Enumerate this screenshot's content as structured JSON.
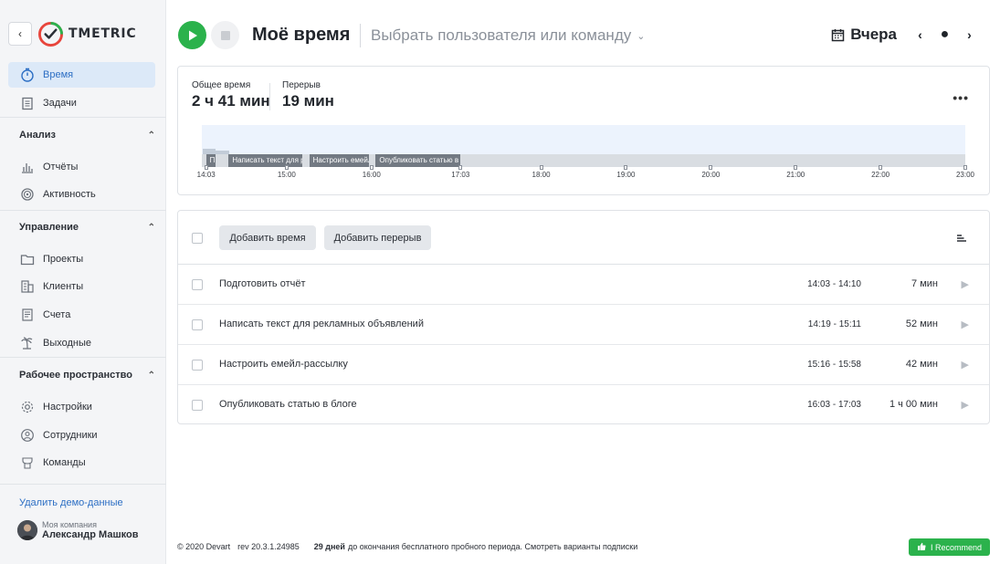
{
  "brand": {
    "name": "TMETRIC",
    "accent": "#2bb24c",
    "link": "#2d6fc4"
  },
  "sidebar": {
    "collapse_icon": "chevron-left-icon",
    "nav_top": [
      {
        "label": "Время",
        "icon": "stopwatch-icon",
        "active": true
      },
      {
        "label": "Задачи",
        "icon": "clipboard-icon",
        "active": false
      }
    ],
    "sections": [
      {
        "title": "Анализ",
        "items": [
          {
            "label": "Отчёты",
            "icon": "bar-chart-icon"
          },
          {
            "label": "Активность",
            "icon": "activity-icon"
          }
        ]
      },
      {
        "title": "Управление",
        "items": [
          {
            "label": "Проекты",
            "icon": "folder-icon"
          },
          {
            "label": "Клиенты",
            "icon": "building-icon"
          },
          {
            "label": "Счета",
            "icon": "invoice-icon"
          },
          {
            "label": "Выходные",
            "icon": "palm-tree-icon"
          }
        ]
      },
      {
        "title": "Рабочее пространство",
        "items": [
          {
            "label": "Настройки",
            "icon": "gear-icon"
          },
          {
            "label": "Сотрудники",
            "icon": "person-icon"
          },
          {
            "label": "Команды",
            "icon": "team-icon"
          }
        ]
      }
    ],
    "demo_link": "Удалить демо-данные",
    "user": {
      "company": "Моя компания",
      "name": "Александр Машков"
    }
  },
  "header": {
    "title": "Моё время",
    "user_select": "Выбрать пользователя или команду",
    "date_label": "Вчера"
  },
  "summary": {
    "total_label": "Общее время",
    "total_value": "2 ч 41 мин",
    "break_label": "Перерыв",
    "break_value": "19 мин",
    "timeline": {
      "ticks": [
        "14:03",
        "15:00",
        "16:00",
        "17:03",
        "18:00",
        "19:00",
        "20:00",
        "21:00",
        "22:00",
        "23:00"
      ],
      "segments": [
        {
          "label": "П",
          "start": "14:03",
          "end": "14:10"
        },
        {
          "label": "Написать текст для рекламных объявлений",
          "start": "14:19",
          "end": "15:11"
        },
        {
          "label": "Настроить емейл-рассылку",
          "start": "15:16",
          "end": "15:58"
        },
        {
          "label": "Опубликовать статью в блоге",
          "start": "16:03",
          "end": "17:03"
        }
      ]
    }
  },
  "toolbar": {
    "add_time": "Добавить время",
    "add_break": "Добавить перерыв"
  },
  "entries": [
    {
      "description": "Подготовить отчёт",
      "range": "14:03 - 14:10",
      "duration": "7 мин"
    },
    {
      "description": "Написать текст для рекламных объявлений",
      "range": "14:19 - 15:11",
      "duration": "52 мин"
    },
    {
      "description": "Настроить емейл-рассылку",
      "range": "15:16 - 15:58",
      "duration": "42 мин"
    },
    {
      "description": "Опубликовать статью в блоге",
      "range": "16:03 - 17:03",
      "duration": "1 ч 00 мин"
    }
  ],
  "footer": {
    "copyright": "© 2020 Devart",
    "revision": "rev 20.3.1.24985",
    "trial_days": "29 дней",
    "trial_text": "до окончания бесплатного пробного периода. Смотреть варианты подписки",
    "recommend": "I Recommend"
  }
}
